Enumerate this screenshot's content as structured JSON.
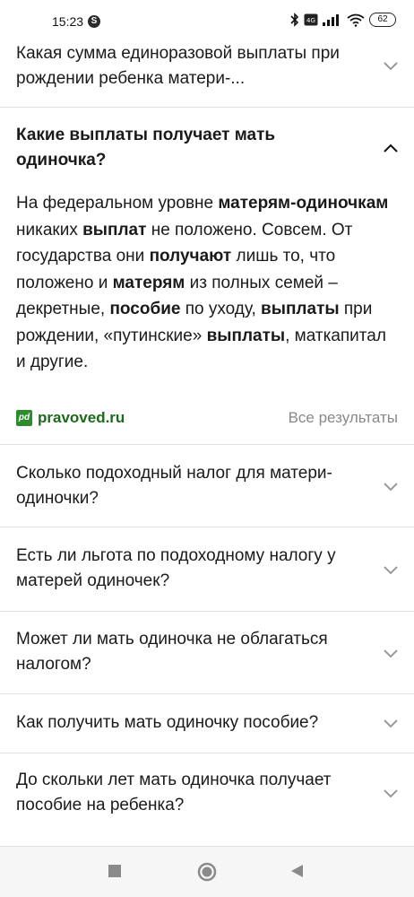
{
  "status_bar": {
    "time": "15:23",
    "app_icon_letter": "S",
    "battery": "62"
  },
  "faq": {
    "q0": "Какая сумма единоразовой выплаты при рождении ребенка матери-...",
    "q1": "Какие выплаты получает мать одиночка?",
    "answer": {
      "s1": "На федеральном уровне ",
      "b1": "матерям-одиночкам",
      "s2": " никаких ",
      "b2": "выплат",
      "s3": " не положено. Совсем. От государства они ",
      "b3": "получают",
      "s4": " лишь то, что положено и ",
      "b4": "матерям",
      "s5": " из полных семей – декретные, ",
      "b5": "пособие",
      "s6": " по уходу, ",
      "b6": "выплаты",
      "s7": " при рождении, «путинские» ",
      "b7": "выплаты",
      "s8": ", маткапитал и другие."
    },
    "source_logo": "pd",
    "source_name": "pravoved.ru",
    "all_results": "Все результаты",
    "q2": "Сколько подоходный налог для матери-одиночки?",
    "q3": "Есть ли льгота по подоходному налогу у матерей одиночек?",
    "q4": "Может ли мать одиночка не облагаться налогом?",
    "q5": "Как получить мать одиночку пособие?",
    "q6": "До скольки лет мать одиночка получает пособие на ребенка?"
  },
  "nav_bar": {
    "recents_icon": "square-icon",
    "home_icon": "circle-icon",
    "back_icon": "triangle-back-icon"
  }
}
